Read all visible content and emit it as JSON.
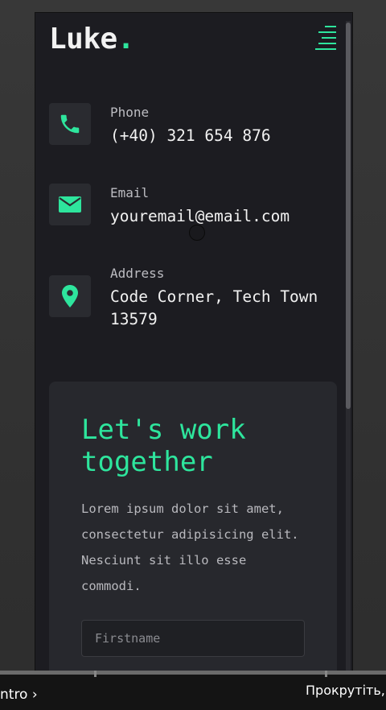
{
  "header": {
    "logo_text": "Luke",
    "logo_dot": "."
  },
  "contacts": [
    {
      "icon": "phone-icon",
      "label": "Phone",
      "value": "(+40) 321 654 876"
    },
    {
      "icon": "mail-icon",
      "label": "Email",
      "value": "youremail@email.com"
    },
    {
      "icon": "location-pin-icon",
      "label": "Address",
      "value_line1": "Code Corner, Tech Town",
      "value_line2": "13579"
    }
  ],
  "card": {
    "title_line1": "Let's work",
    "title_line2": "together",
    "text_lines": [
      "Lorem ipsum dolor sit amet,",
      "consectetur adipisicing elit.",
      "Nesciunt sit illo esse",
      "commodi."
    ],
    "firstname_placeholder": "Firstname"
  },
  "overlay": {
    "left_label": "ntro",
    "left_chevron": "›",
    "right_label": "Прокрутіть,"
  },
  "colors": {
    "accent": "#2ee59d",
    "background": "#1c1c21",
    "card": "#27282d"
  }
}
